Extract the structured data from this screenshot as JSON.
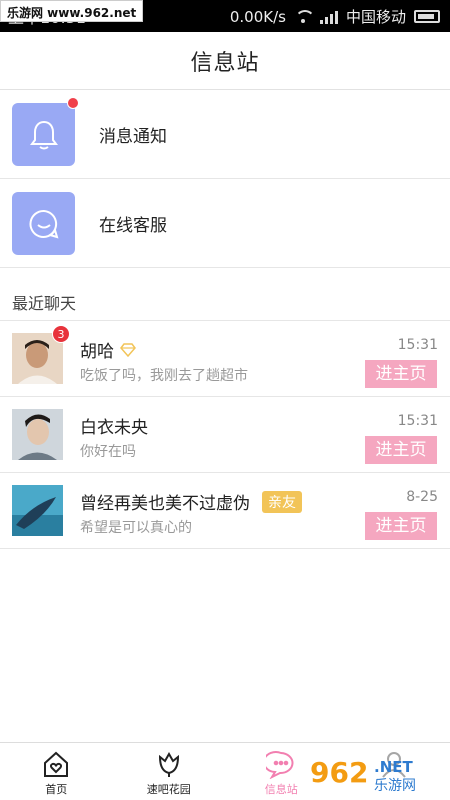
{
  "status_bar": {
    "watermark": "乐游网 www.962.net",
    "time": "上午10:51",
    "speed": "0.00K/s",
    "carrier": "中国移动"
  },
  "header": {
    "title": "信息站"
  },
  "services": [
    {
      "label": "消息通知",
      "icon": "bell-icon",
      "has_dot": true
    },
    {
      "label": "在线客服",
      "icon": "chat-smile-icon",
      "has_dot": false
    }
  ],
  "recent": {
    "title": "最近聊天",
    "chats": [
      {
        "name": "胡哈",
        "badge": "3",
        "message": "吃饭了吗，我刚去了趟超市",
        "time": "15:31",
        "button": "进主页",
        "vip": true,
        "tag": ""
      },
      {
        "name": "白衣未央",
        "badge": "",
        "message": "你好在吗",
        "time": "15:31",
        "button": "进主页",
        "vip": false,
        "tag": ""
      },
      {
        "name": "曾经再美也美不过虚伪",
        "badge": "",
        "message": "希望是可以真心的",
        "time": "8-25",
        "button": "进主页",
        "vip": false,
        "tag": "亲友"
      }
    ]
  },
  "nav": {
    "items": [
      {
        "label": "首页",
        "icon": "home-heart-icon"
      },
      {
        "label": "速吧花园",
        "icon": "tulip-icon"
      },
      {
        "label": "信息站",
        "icon": "chat-bubble-icon",
        "active": true
      },
      {
        "label": "",
        "icon": "user-icon"
      }
    ]
  },
  "colors": {
    "accent_pink": "#f5a7c0",
    "nav_active": "#f27fb0",
    "service_icon_bg": "#99a9f4",
    "badge_red": "#e8333c",
    "tag_yellow": "#f2c458"
  }
}
